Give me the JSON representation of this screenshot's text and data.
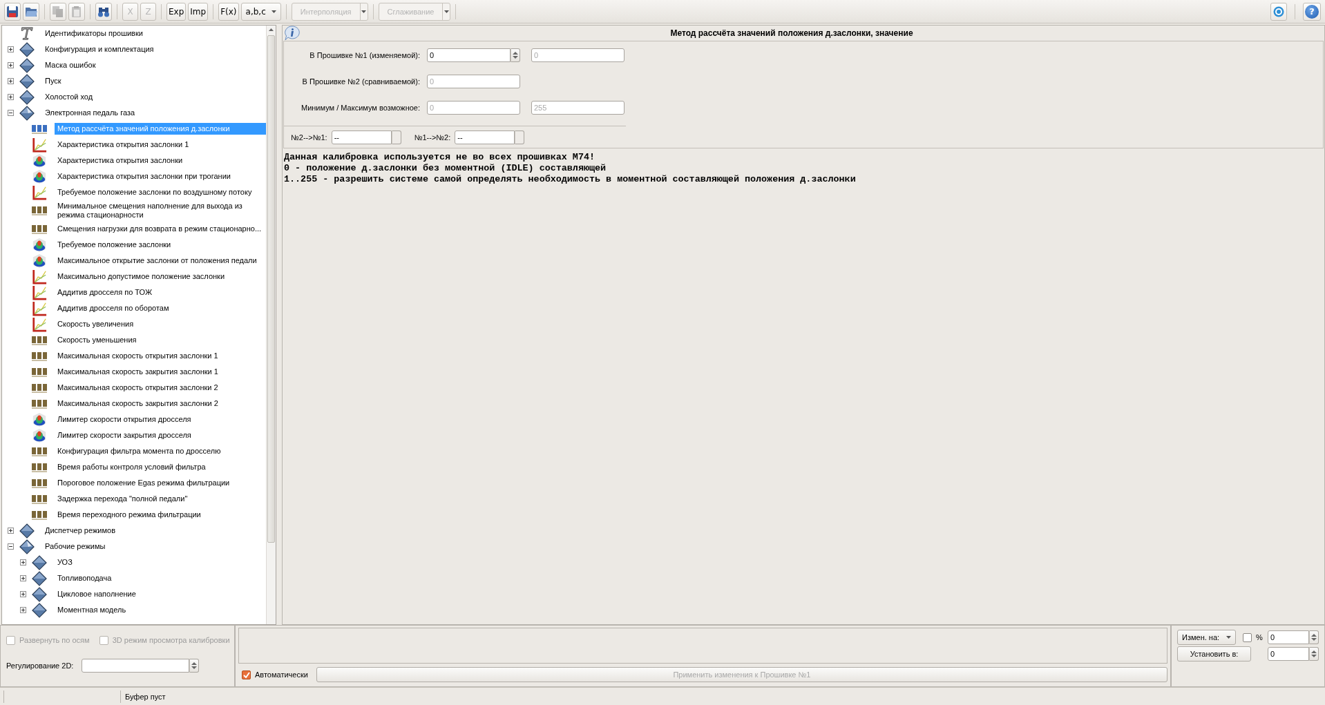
{
  "toolbar": {
    "items": [
      {
        "kind": "save",
        "disabled": false
      },
      {
        "kind": "open",
        "disabled": false
      },
      {
        "kind": "separator"
      },
      {
        "kind": "copy",
        "disabled": true
      },
      {
        "kind": "paste",
        "disabled": true
      },
      {
        "kind": "separator"
      },
      {
        "kind": "find",
        "disabled": false
      },
      {
        "kind": "separator"
      },
      {
        "kind": "text",
        "label": "X",
        "disabled": true
      },
      {
        "kind": "text",
        "label": "Z",
        "disabled": true
      },
      {
        "kind": "separator"
      },
      {
        "kind": "text",
        "label": "Exp",
        "disabled": false
      },
      {
        "kind": "text",
        "label": "Imp",
        "disabled": false
      },
      {
        "kind": "separator"
      },
      {
        "kind": "text",
        "label": "F(x)",
        "disabled": false
      },
      {
        "kind": "dropdown",
        "label": "a,b,c",
        "disabled": false
      },
      {
        "kind": "separator"
      },
      {
        "kind": "split",
        "label": "Интерполяция",
        "disabled": true
      },
      {
        "kind": "separator"
      },
      {
        "kind": "split",
        "label": "Сглаживание",
        "disabled": true
      },
      {
        "kind": "separator"
      }
    ],
    "right": [
      {
        "kind": "settings"
      },
      {
        "kind": "help",
        "symbol": "?"
      }
    ]
  },
  "tree": {
    "items": [
      {
        "label": "Идентификаторы прошивки",
        "kind": "text",
        "selected": false
      },
      {
        "label": "Конфигурация и комплектация",
        "kind": "folder",
        "expanded": false,
        "selected": false
      },
      {
        "label": "Маска ошибок",
        "kind": "folder",
        "expanded": false,
        "selected": false
      },
      {
        "label": "Пуск",
        "kind": "folder",
        "expanded": false,
        "selected": false
      },
      {
        "label": "Холостой ход",
        "kind": "folder",
        "expanded": false,
        "selected": false
      },
      {
        "label": "Электронная педаль газа",
        "kind": "folder",
        "expanded": true,
        "selected": false,
        "children": [
          {
            "label": "Метод рассчёта значений положения д.заслонки",
            "kind": "number",
            "selected": true
          },
          {
            "label": "Характеристика открытия заслонки 1",
            "kind": "curve",
            "selected": false
          },
          {
            "label": "Характеристика открытия заслонки",
            "kind": "surface",
            "selected": false
          },
          {
            "label": "Характеристика открытия заслонки при трогании",
            "kind": "surface",
            "selected": false
          },
          {
            "label": "Требуемое положение заслонки по воздушному потоку",
            "kind": "curve",
            "selected": false
          },
          {
            "label": "Минимальное смещения наполнение для выхода из режима стационарности",
            "kind": "number",
            "selected": false
          },
          {
            "label": "Смещения нагрузки для возврата в режим стационарно...",
            "kind": "number",
            "selected": false
          },
          {
            "label": "Требуемое положение заслонки",
            "kind": "surface",
            "selected": false
          },
          {
            "label": "Максимальное открытие заслонки от положения педали",
            "kind": "surface",
            "selected": false
          },
          {
            "label": "Максимально допустимое положение заслонки",
            "kind": "curve",
            "selected": false
          },
          {
            "label": "Аддитив дросселя по ТОЖ",
            "kind": "curve",
            "selected": false
          },
          {
            "label": "Аддитив дросселя по оборотам",
            "kind": "curve",
            "selected": false
          },
          {
            "label": "Скорость увеличения",
            "kind": "curve",
            "selected": false
          },
          {
            "label": "Скорость уменьшения",
            "kind": "number",
            "selected": false
          },
          {
            "label": "Максимальная скорость открытия заслонки 1",
            "kind": "number",
            "selected": false
          },
          {
            "label": "Максимальная скорость закрытия заслонки 1",
            "kind": "number",
            "selected": false
          },
          {
            "label": "Максимальная скорость открытия заслонки 2",
            "kind": "number",
            "selected": false
          },
          {
            "label": "Максимальная скорость закрытия заслонки 2",
            "kind": "number",
            "selected": false
          },
          {
            "label": "Лимитер скорости открытия дросселя",
            "kind": "surface",
            "selected": false
          },
          {
            "label": "Лимитер скорости закрытия дросселя",
            "kind": "surface",
            "selected": false
          },
          {
            "label": "Конфигурация фильтра момента по дросселю",
            "kind": "number",
            "selected": false
          },
          {
            "label": "Время работы контроля условий фильтра",
            "kind": "number",
            "selected": false
          },
          {
            "label": "Пороговое положение Egas режима фильтрации",
            "kind": "number",
            "selected": false
          },
          {
            "label": "Задержка перехода \"полной педали\"",
            "kind": "number",
            "selected": false
          },
          {
            "label": "Время переходного режима фильтрации",
            "kind": "number",
            "selected": false
          }
        ]
      },
      {
        "label": "Диспетчер режимов",
        "kind": "folder",
        "expanded": false,
        "selected": false
      },
      {
        "label": "Рабочие режимы",
        "kind": "folder",
        "expanded": true,
        "selected": false,
        "children": [
          {
            "label": "УОЗ",
            "kind": "folder",
            "expanded": false,
            "selected": false
          },
          {
            "label": "Топливоподача",
            "kind": "folder",
            "expanded": false,
            "selected": false
          },
          {
            "label": "Цикловое наполнение",
            "kind": "folder",
            "expanded": false,
            "selected": false
          },
          {
            "label": "Моментная модель",
            "kind": "folder",
            "expanded": false,
            "selected": false
          }
        ]
      }
    ]
  },
  "detail": {
    "title": "Метод рассчёта значений положения д.заслонки, значение",
    "form": {
      "rows": [
        {
          "label": "В Прошивке №1 (изменяемой):",
          "fields": [
            {
              "kind": "spin",
              "value": "0",
              "disabled": false
            },
            {
              "kind": "text",
              "value": "0",
              "disabled": true
            }
          ]
        },
        {
          "label": "В Прошивке №2 (сравниваемой):",
          "fields": [
            {
              "kind": "text",
              "value": "0",
              "disabled": true
            }
          ]
        },
        {
          "label": "Минимум / Максимум возможное:",
          "fields": [
            {
              "kind": "text",
              "value": "0",
              "disabled": true
            },
            {
              "kind": "text",
              "value": "255",
              "disabled": true
            }
          ]
        }
      ],
      "copy": [
        {
          "label": "№2-->№1:",
          "value": "--"
        },
        {
          "label": "№1-->№2:",
          "value": "--"
        }
      ]
    },
    "description": [
      "Данная калибровка используется не во всех прошивках М74!",
      "0 - положение д.заслонки без моментной (IDLE) составляющей",
      "1..255 - разрешить системе самой определять необходимость в моментной составляющей положения д.заслонки"
    ]
  },
  "bottom": {
    "view_options": [
      {
        "label": "Развернуть по осям",
        "checked": false,
        "disabled": true
      },
      {
        "label": "3D режим просмотра калибровки",
        "checked": false,
        "disabled": true
      }
    ],
    "regulation_label": "Регулирование 2D:",
    "auto_apply": {
      "label": "Автоматически",
      "checked": true
    },
    "apply_button": {
      "label": "Применить изменения к Прошивке №1",
      "disabled": true
    },
    "change_mode": "Измен. на:",
    "percent": {
      "label": "%",
      "checked": false
    },
    "change_value": "0",
    "set_button": "Установить в:",
    "set_value": "0"
  },
  "status_bar": {
    "message": "Буфер пуст"
  }
}
